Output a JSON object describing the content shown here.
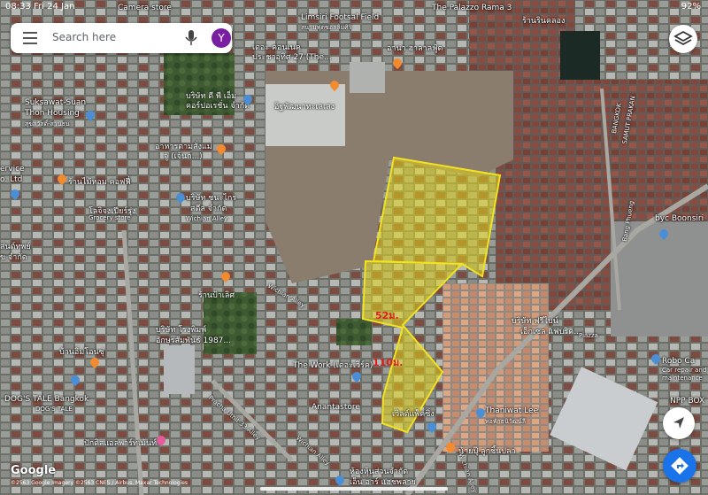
{
  "status_bar": {
    "time": "08:33",
    "date": "Fri 24 Jan",
    "battery": "92%"
  },
  "search": {
    "placeholder": "Search here",
    "avatar_letter": "Y"
  },
  "colors": {
    "parcel_fill": "#e6d61c",
    "parcel_outline": "#f2e21f",
    "dimension_text": "#e01b1b",
    "avatar": "#7b1fa2",
    "directions_button": "#1a73e8"
  },
  "dimensions": {
    "d1": "52ม.",
    "d2": "110ม."
  },
  "map_labels": {
    "camera_store": "Camera store",
    "palazzo": "The Palazzo Rama 3",
    "limsiri": "Limsiri Footsal Field",
    "limsiri_th": "สนามฟุตซอลลิมศิริ",
    "store_top_right": "ร้านรินคลอง",
    "condo": "เดอะ คอนเนค",
    "condo2": "ประชาอุทิศ 27 (The...",
    "ana_food": "อาน่า ฮาลาลฟู้ด",
    "th_company1": "บริษัท ดี พี เอ็ม",
    "th_company1b": "คอร์ปอเรชั่น จำกัด",
    "hygiene": "อิฐพัฒนาทะเลเสง",
    "suksawat": "Suksawat-Suan",
    "thon": "Thon Housing",
    "suksawat_th": "สุขสวัสดิ์-สวนธน",
    "restaurant_th": "อาหารตามสั่งแม่",
    "restaurant_th2": "จู้ (เจ้นก...)",
    "service": "ervice",
    "service2": "o. Ltd",
    "coffee": "ร้านไม้หอม คอฟฟี่",
    "grocery_th": "โลจิจงเปียร์รุ่ง",
    "grocery": "Grocery store",
    "th_company2": "บริษัท ชนะไกร",
    "th_company2b": "สตีล จำกัด",
    "wichian_alley": "Wichian Alley",
    "th_left1": "ส่นต์ทพย์",
    "th_left2": "ข จำกัด",
    "bangkok": "BANGKOK",
    "samut": "SAMUT PRAKAN",
    "byc": "byc Boonsiri",
    "bang_kruai": "Bang Phueng",
    "store_pak": "ร้านป้าเลิศ",
    "wichian_alley2": "Wichian Alley",
    "th_company3": "บริษัท โรงพิมพ์",
    "th_company3b": "อักษรสัมพันธ์ 1987...",
    "th_company4": "บริษัท ฟรีไบน์",
    "th_company4b": "เอ็กเซล แฟบริค...",
    "piazza": "Piazza",
    "store_pink": "บ้านอิ่มโอนซุ่",
    "the_work": "The Work (เดอะเวิร์ค)",
    "dogs_tale": "DOG'S TALE Bangkok",
    "dogs_tale2": "DOG'S TALE",
    "anantastore": "Anantastore",
    "pracha": "Pracha Uthit 33 Alley",
    "factory": "เวิลด์แพ็คซิ่ง",
    "thaniwat": "Thaniwat Lee",
    "thaniwat_th": "หอพักธนิวัฒน์ลี",
    "repair": "Car repair and",
    "repair2": "maintenance",
    "npp": "NPP BOX",
    "robo": "Robo Ca",
    "barber": "ปักดิสแอลพาร์ทเม้นท์",
    "shop_bottom": "น้ายปุ๊ ลูกชิ้นปลา",
    "wichian_alley3": "Wichian Alley",
    "th_bottom": "ห้องหุ้นส่วนจำกัด",
    "th_bottom2": "เอ็น อาร์ แฮชพลาย",
    "wichian4": "Wichian Alley",
    "google": "Google",
    "copyright": "©2563 Google Imagery ©2563 CNES / Airbus, Maxar Technologies"
  }
}
